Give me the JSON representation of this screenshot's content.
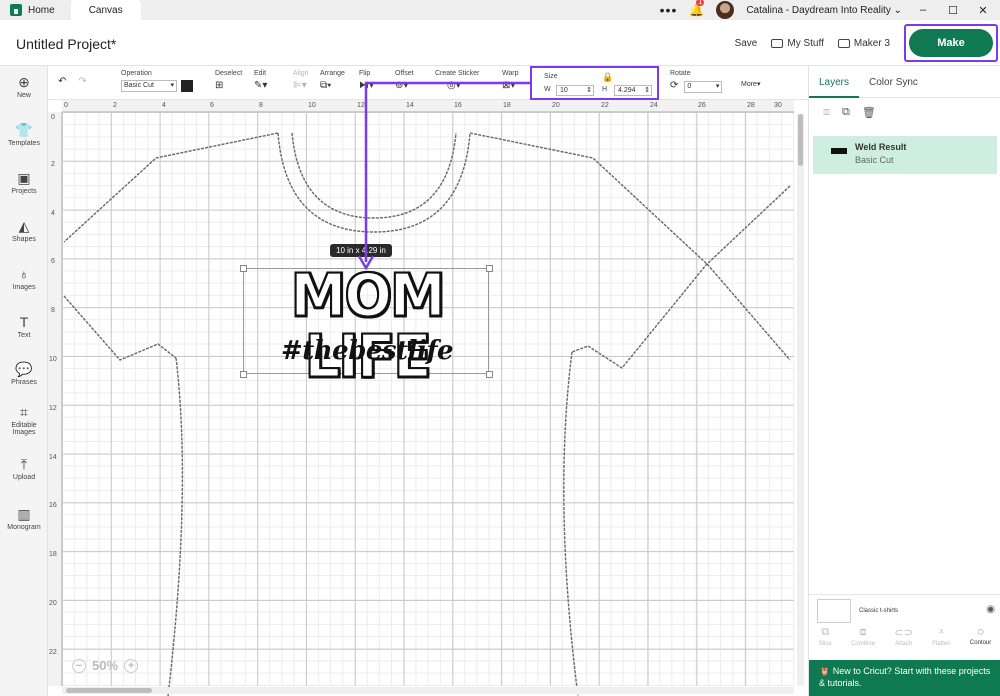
{
  "titlebar": {
    "home_tab": "Home",
    "canvas_tab": "Canvas",
    "notification_count": "1",
    "user_label": "Catalina - Daydream Into Reality"
  },
  "header": {
    "project_title": "Untitled Project*",
    "save_label": "Save",
    "my_stuff_label": "My Stuff",
    "machine_label": "Maker 3",
    "make_label": "Make"
  },
  "sidebar": {
    "items": [
      {
        "label": "New",
        "icon": "plus-circle-icon"
      },
      {
        "label": "Templates",
        "icon": "shirt-icon"
      },
      {
        "label": "Projects",
        "icon": "projects-icon"
      },
      {
        "label": "Shapes",
        "icon": "shapes-icon"
      },
      {
        "label": "Images",
        "icon": "bulb-icon"
      },
      {
        "label": "Text",
        "icon": "text-icon"
      },
      {
        "label": "Phrases",
        "icon": "speech-bubble-icon"
      },
      {
        "label": "Editable Images",
        "icon": "editable-images-icon"
      },
      {
        "label": "Upload",
        "icon": "upload-icon"
      },
      {
        "label": "Monogram",
        "icon": "monogram-icon"
      }
    ]
  },
  "toolbar": {
    "operation_label": "Operation",
    "operation_value": "Basic Cut",
    "deselect_label": "Deselect",
    "edit_label": "Edit",
    "align_label": "Align",
    "arrange_label": "Arrange",
    "flip_label": "Flip",
    "offset_label": "Offset",
    "create_sticker_label": "Create Sticker",
    "warp_label": "Warp",
    "size_label": "Size",
    "w_label": "W",
    "w_value": "10",
    "h_label": "H",
    "h_value": "4.294",
    "rotate_label": "Rotate",
    "rotate_value": "0",
    "more_label": "More▾"
  },
  "canvas": {
    "ruler_top": [
      "0",
      "2",
      "4",
      "6",
      "8",
      "10",
      "12",
      "14",
      "16",
      "18",
      "20",
      "22",
      "24",
      "26",
      "28",
      "30"
    ],
    "ruler_left": [
      "0",
      "2",
      "4",
      "6",
      "8",
      "10",
      "12",
      "14",
      "16",
      "18",
      "20",
      "22"
    ],
    "dimension_tip": "10  in  x  4.29  in",
    "design_line1": "MOM LIFE",
    "design_line2": "#thebestlife",
    "zoom_value": "50%"
  },
  "layers_panel": {
    "tab_layers": "Layers",
    "tab_color_sync": "Color Sync",
    "layer_title": "Weld Result",
    "layer_subtitle": "Basic Cut",
    "canvas_template_label": "Classic t-shirts",
    "tools": [
      "Slice",
      "Combine",
      "Attach",
      "Flatten",
      "Contour"
    ],
    "promo_text": "New to Cricut? Start with these projects & tutorials."
  },
  "colors": {
    "brand_green": "#0f7a52",
    "highlight_purple": "#7c3aed",
    "layer_selected_bg": "#cdeee0"
  }
}
